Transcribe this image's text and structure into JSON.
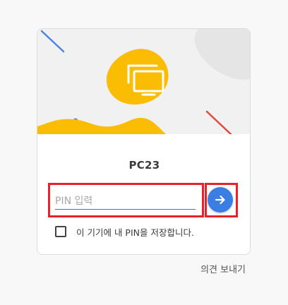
{
  "device": {
    "name": "PC23"
  },
  "pin_form": {
    "placeholder": "PIN 입력",
    "value": "",
    "submit_icon": "arrow-right-icon",
    "remember_label": "이 기기에 내 PIN을 저장합니다.",
    "remember_checked": false
  },
  "footer": {
    "feedback_label": "의견 보내기"
  },
  "colors": {
    "accent": "#3b7ee3",
    "hero_blob": "#fbbc04",
    "highlight": "#e8212b"
  }
}
